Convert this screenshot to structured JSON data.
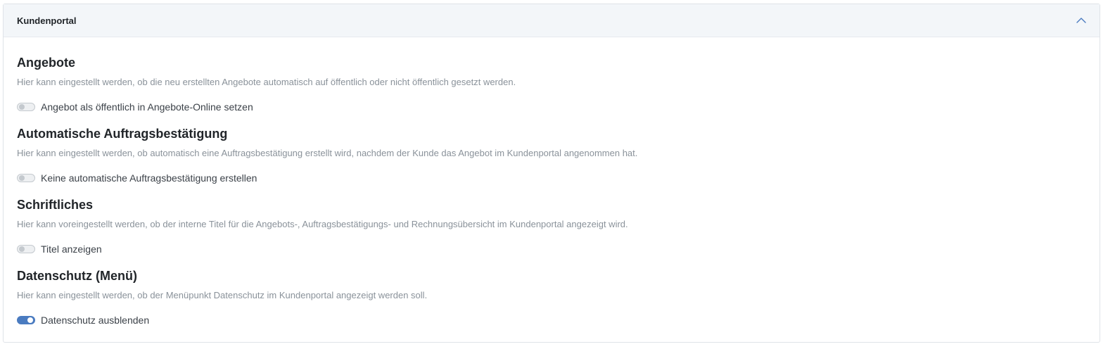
{
  "card": {
    "title": "Kundenportal",
    "collapse_icon": "chevron-up-icon"
  },
  "sections": [
    {
      "title": "Angebote",
      "description": "Hier kann eingestellt werden, ob die neu erstellten Angebote automatisch auf öffentlich oder nicht öffentlich gesetzt werden.",
      "toggle_label": "Angebot als öffentlich in Angebote-Online setzen",
      "toggle_on": false
    },
    {
      "title": "Automatische Auftragsbestätigung",
      "description": "Hier kann eingestellt werden, ob automatisch eine Auftragsbestätigung erstellt wird, nachdem der Kunde das Angebot im Kundenportal angenommen hat.",
      "toggle_label": "Keine automatische Auftragsbestätigung erstellen",
      "toggle_on": false
    },
    {
      "title": "Schriftliches",
      "description": "Hier kann voreingestellt werden, ob der interne Titel für die Angebots-, Auftragsbestätigungs- und Rechnungsübersicht im Kundenportal angezeigt wird.",
      "toggle_label": "Titel anzeigen",
      "toggle_on": false
    },
    {
      "title": "Datenschutz (Menü)",
      "description": "Hier kann eingestellt werden, ob der Menüpunkt Datenschutz im Kundenportal angezeigt werden soll.",
      "toggle_label": "Datenschutz ausblenden",
      "toggle_on": true
    }
  ],
  "colors": {
    "accent": "#4a7bc0",
    "header_bg": "#f3f6f9",
    "muted_text": "#8a929a"
  }
}
